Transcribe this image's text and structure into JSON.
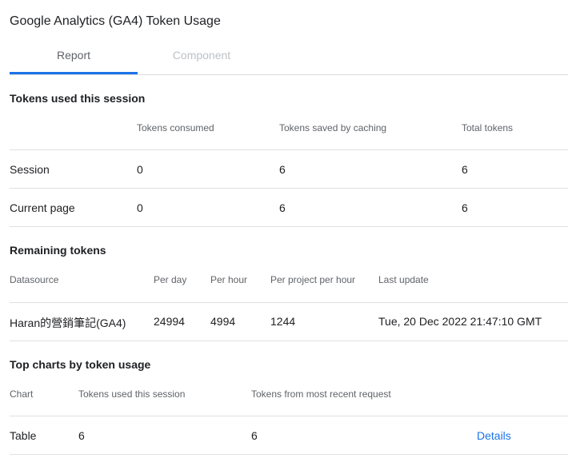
{
  "app_title": "Google Analytics (GA4) Token Usage",
  "tabs": [
    {
      "label": "Report",
      "active": true
    },
    {
      "label": "Component",
      "active": false
    }
  ],
  "session_section": {
    "title": "Tokens used this session",
    "headers": [
      "Tokens consumed",
      "Tokens saved by caching",
      "Total tokens"
    ],
    "rows": [
      {
        "label": "Session",
        "consumed": "0",
        "saved": "6",
        "total": "6"
      },
      {
        "label": "Current page",
        "consumed": "0",
        "saved": "6",
        "total": "6"
      }
    ]
  },
  "remaining_section": {
    "title": "Remaining tokens",
    "headers": [
      "Datasource",
      "Per day",
      "Per hour",
      "Per project per hour",
      "Last update"
    ],
    "rows": [
      {
        "datasource": "Haran的營銷筆記(GA4)",
        "per_day": "24994",
        "per_hour": "4994",
        "per_project_per_hour": "1244",
        "last_update": "Tue, 20 Dec 2022 21:47:10 GMT"
      }
    ]
  },
  "top_charts_section": {
    "title": "Top charts by token usage",
    "headers": [
      "Chart",
      "Tokens used this session",
      "Tokens from most recent request"
    ],
    "rows": [
      {
        "chart": "Table",
        "session_tokens": "6",
        "recent_tokens": "6",
        "details_label": "Details"
      }
    ]
  },
  "colors": {
    "accent": "#1a73e8",
    "divider": "#e0e0e0",
    "header_text": "#5f6368"
  }
}
